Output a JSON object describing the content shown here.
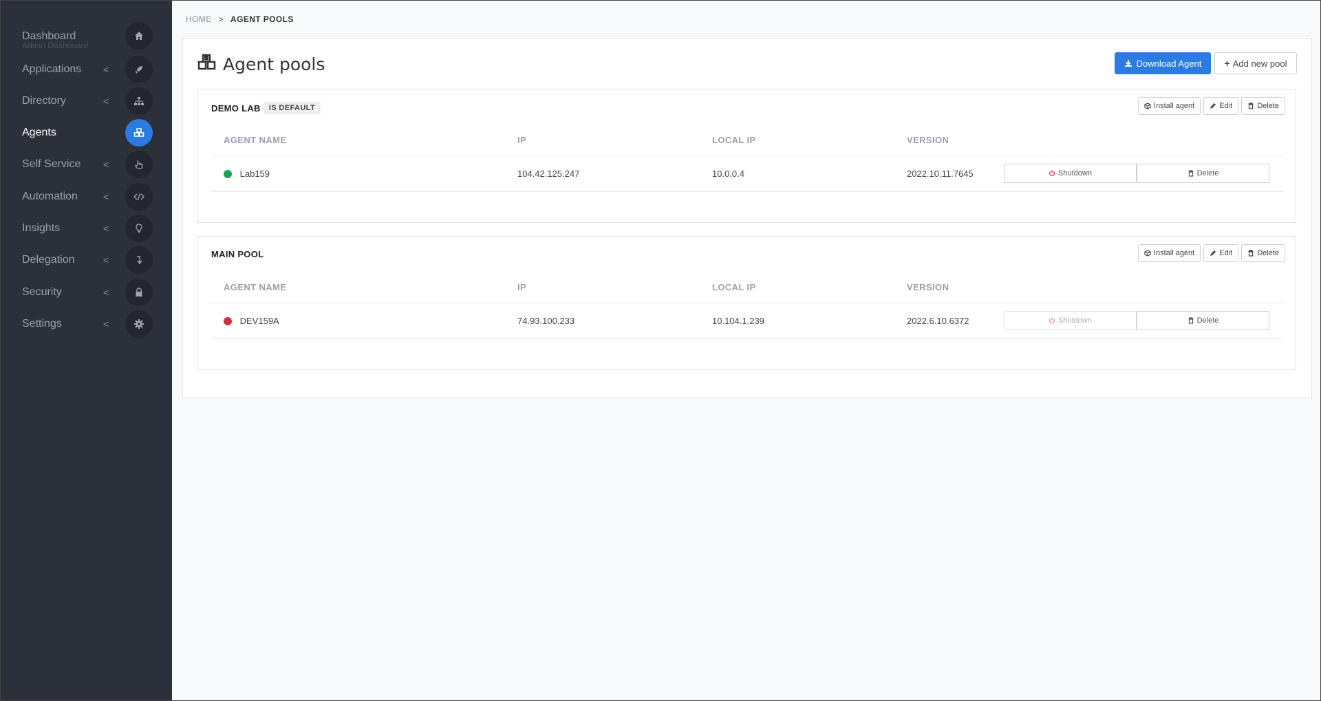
{
  "sidebar": {
    "items": [
      {
        "label": "Dashboard",
        "sub": "Admin Dashboard",
        "icon": "home-icon",
        "active": false
      },
      {
        "label": "Applications",
        "icon": "rocket-icon",
        "active": false
      },
      {
        "label": "Directory",
        "icon": "sitemap-icon",
        "active": false
      },
      {
        "label": "Agents",
        "icon": "cubes-icon",
        "active": true
      },
      {
        "label": "Self Service",
        "icon": "hand-pointer-icon",
        "active": false
      },
      {
        "label": "Automation",
        "icon": "code-icon",
        "active": false
      },
      {
        "label": "Insights",
        "icon": "lightbulb-icon",
        "active": false
      },
      {
        "label": "Delegation",
        "icon": "level-down-icon",
        "active": false
      },
      {
        "label": "Security",
        "icon": "lock-icon",
        "active": false
      },
      {
        "label": "Settings",
        "icon": "gear-icon",
        "active": false
      }
    ],
    "chevron": "<"
  },
  "breadcrumb": {
    "home": "HOME",
    "separator": ">",
    "current": "AGENT POOLS"
  },
  "page": {
    "title": "Agent pools",
    "download_label": "Download Agent",
    "add_pool_label": "Add new pool"
  },
  "table_headers": {
    "name": "AGENT NAME",
    "ip": "IP",
    "local_ip": "LOCAL IP",
    "version": "VERSION"
  },
  "pool_actions": {
    "install": "Install agent",
    "edit": "Edit",
    "delete": "Delete"
  },
  "row_actions": {
    "shutdown": "Shutdown",
    "delete": "Delete"
  },
  "pools": [
    {
      "name": "DEMO LAB",
      "badge": "IS DEFAULT",
      "agents": [
        {
          "name": "Lab159",
          "ip": "104.42.125.247",
          "local_ip": "10.0.0.4",
          "version": "2022.10.11.7645",
          "status": "online",
          "status_color": "#1aa351"
        }
      ]
    },
    {
      "name": "MAIN POOL",
      "badge": "",
      "agents": [
        {
          "name": "DEV159A",
          "ip": "74.93.100.233",
          "local_ip": "10.104.1.239",
          "version": "2022.6.10.6372",
          "status": "offline",
          "status_color": "#dc2b3c"
        }
      ]
    }
  ],
  "colors": {
    "accent": "#2b7be0",
    "sidebar": "#2c303a",
    "online": "#1aa351",
    "offline": "#dc2b3c",
    "shutdown_icon": "#dc2b3c"
  }
}
